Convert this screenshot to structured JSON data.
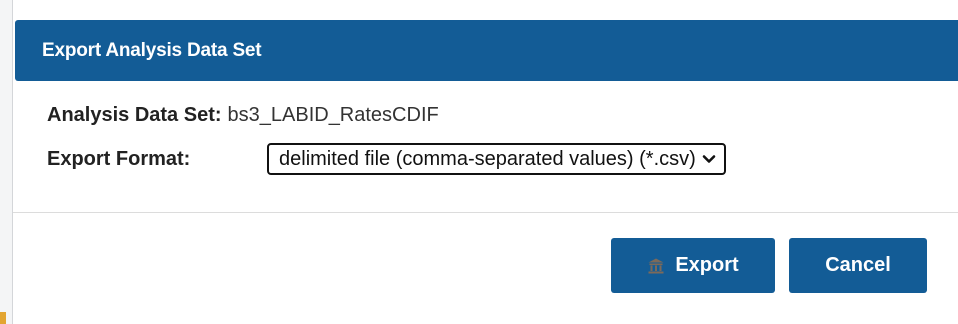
{
  "dialog": {
    "title": "Export Analysis Data Set",
    "dataset_label": "Analysis Data Set:",
    "dataset_value": "bs3_LABID_RatesCDIF",
    "format_label": "Export Format:",
    "format_selected": "delimited file (comma-separated values) (*.csv)",
    "export_label": "Export",
    "cancel_label": "Cancel"
  },
  "icons": {
    "export": "bank-icon",
    "dropdown": "chevron-down-icon"
  },
  "colors": {
    "header_bg": "#135c96",
    "button_bg": "#135c96",
    "button_text": "#ffffff",
    "accent": "#e3a531"
  }
}
